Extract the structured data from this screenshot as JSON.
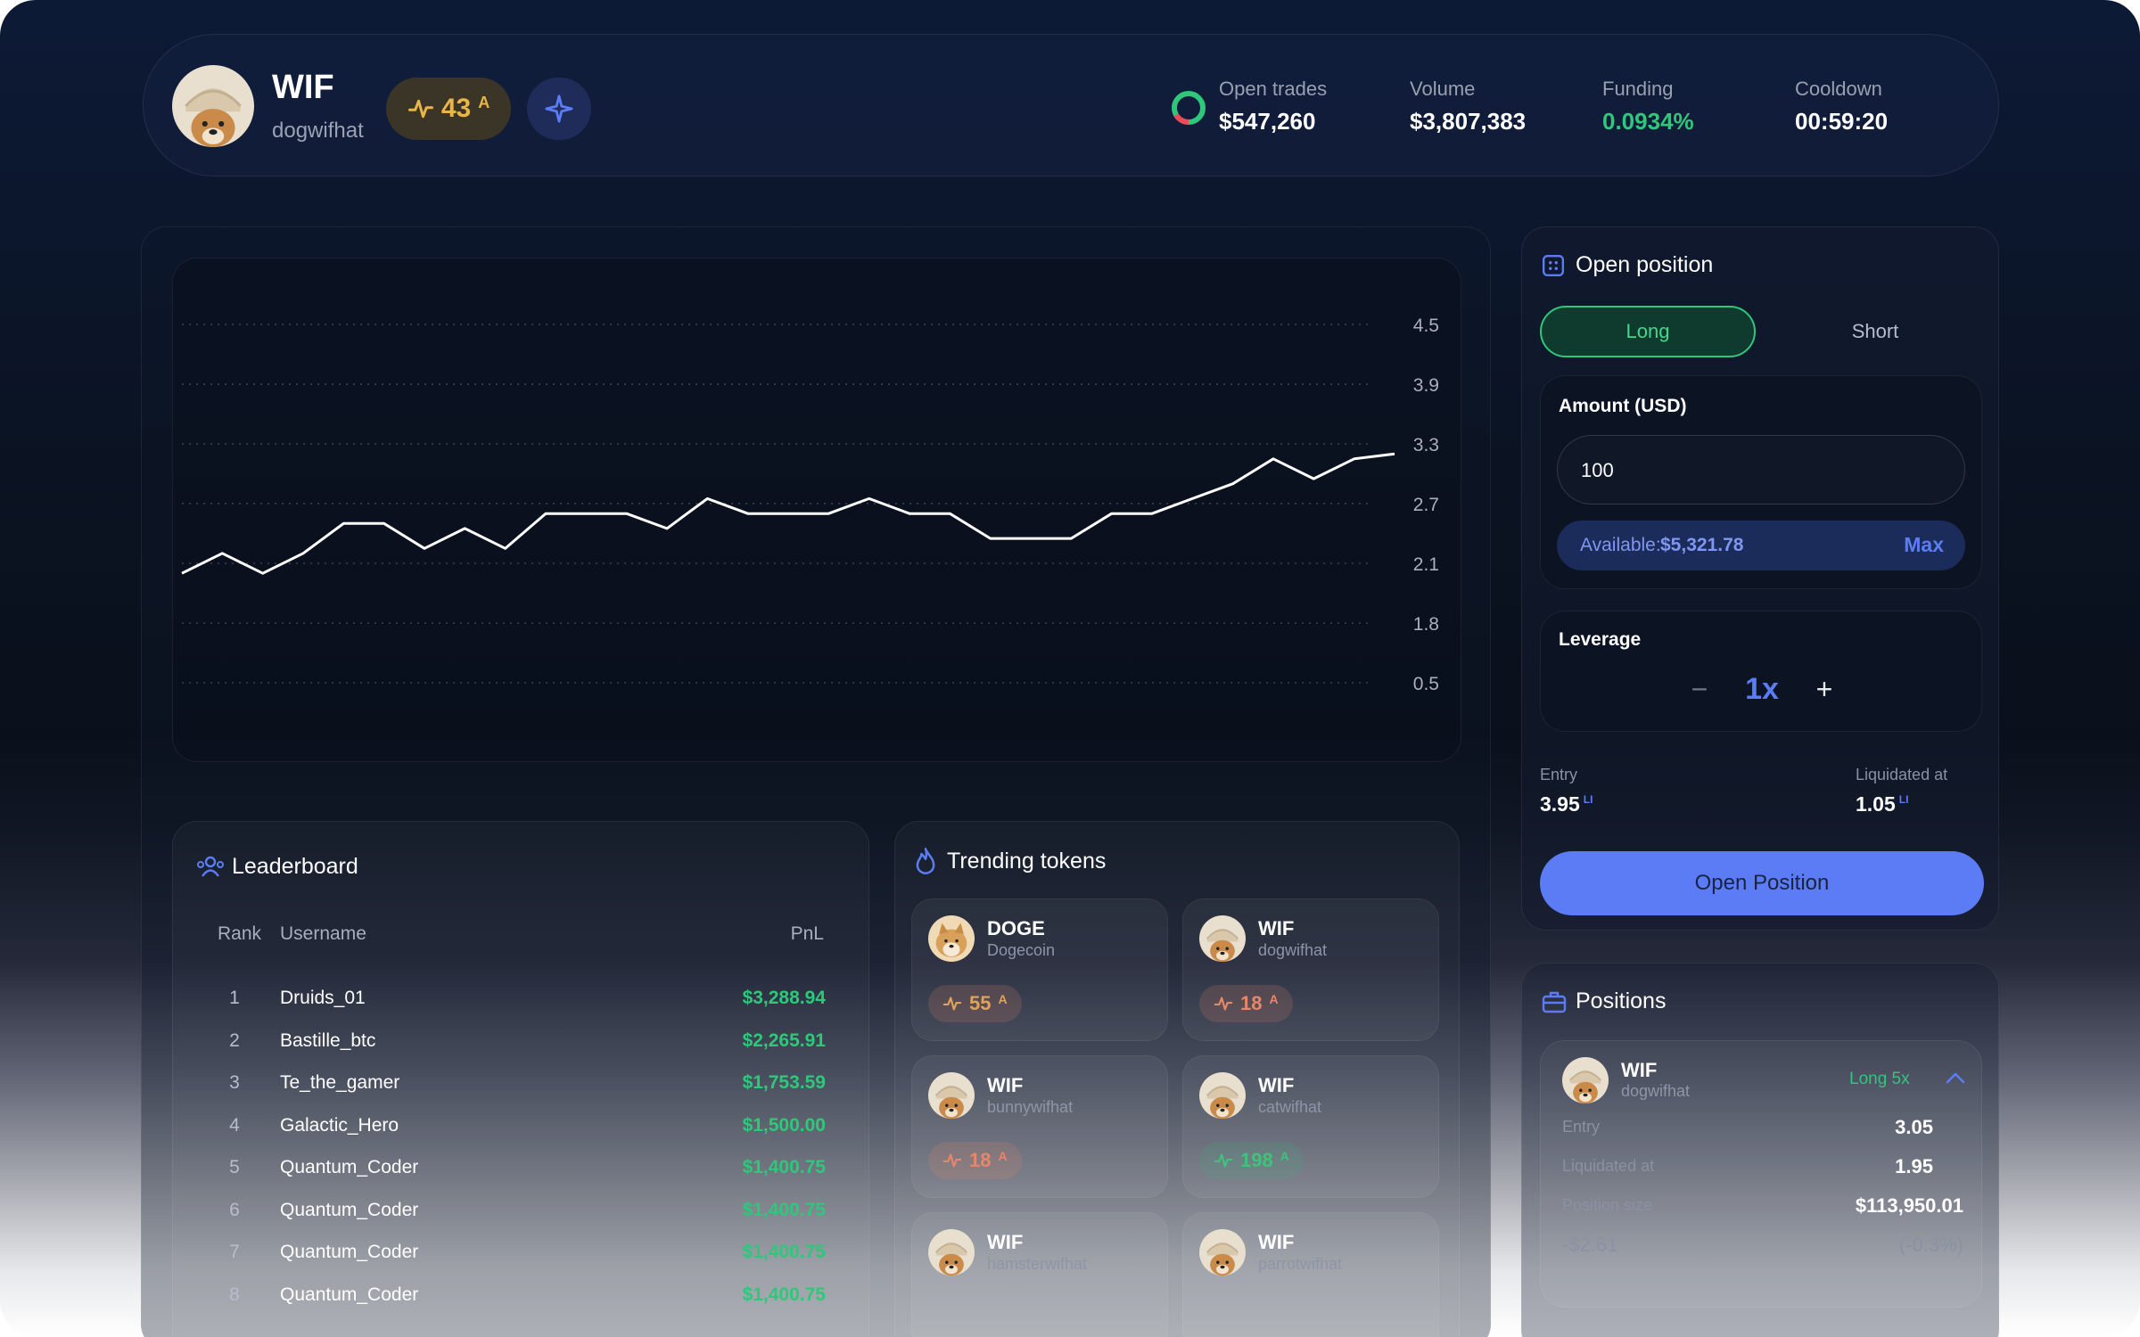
{
  "header": {
    "token_symbol": "WIF",
    "token_name": "dogwifhat",
    "score": "43",
    "score_grade": "A",
    "stats": [
      {
        "label": "Open trades",
        "value": "$547,260"
      },
      {
        "label": "Volume",
        "value": "$3,807,383"
      },
      {
        "label": "Funding",
        "value": "0.0934%"
      },
      {
        "label": "Cooldown",
        "value": "00:59:20"
      }
    ]
  },
  "chart_data": {
    "type": "line",
    "title": "",
    "xlabel": "",
    "ylabel": "",
    "y_tick_labels": [
      "4.5",
      "3.9",
      "3.3",
      "2.7",
      "2.1",
      "1.8",
      "0.5"
    ],
    "ylim": [
      1.5,
      4.5
    ],
    "values": [
      2.0,
      2.2,
      2.0,
      2.2,
      2.5,
      2.5,
      2.25,
      2.45,
      2.25,
      2.6,
      2.6,
      2.6,
      2.45,
      2.75,
      2.6,
      2.6,
      2.6,
      2.75,
      2.6,
      2.6,
      2.35,
      2.35,
      2.35,
      2.6,
      2.6,
      2.75,
      2.9,
      3.15,
      2.95,
      3.15,
      3.2
    ],
    "grid": true
  },
  "leaderboard": {
    "title": "Leaderboard",
    "columns": {
      "rank": "Rank",
      "username": "Username",
      "pnl": "PnL"
    },
    "rows": [
      {
        "rank": "1",
        "username": "Druids_01",
        "pnl": "$3,288.94"
      },
      {
        "rank": "2",
        "username": "Bastille_btc",
        "pnl": "$2,265.91"
      },
      {
        "rank": "3",
        "username": "Te_the_gamer",
        "pnl": "$1,753.59"
      },
      {
        "rank": "4",
        "username": "Galactic_Hero",
        "pnl": "$1,500.00"
      },
      {
        "rank": "5",
        "username": "Quantum_Coder",
        "pnl": "$1,400.75"
      },
      {
        "rank": "6",
        "username": "Quantum_Coder",
        "pnl": "$1,400.75"
      },
      {
        "rank": "7",
        "username": "Quantum_Coder",
        "pnl": "$1,400.75"
      },
      {
        "rank": "8",
        "username": "Quantum_Coder",
        "pnl": "$1,400.75"
      }
    ]
  },
  "trending": {
    "title": "Trending tokens",
    "tokens": [
      {
        "symbol": "DOGE",
        "name": "Dogecoin",
        "score": "55",
        "grade": "A",
        "color": "#e0a25a"
      },
      {
        "symbol": "WIF",
        "name": "dogwifhat",
        "score": "18",
        "grade": "A",
        "color": "#e6866a"
      },
      {
        "symbol": "WIF",
        "name": "bunnywifhat",
        "score": "18",
        "grade": "A",
        "color": "#e6866a"
      },
      {
        "symbol": "WIF",
        "name": "catwifhat",
        "score": "198",
        "grade": "A",
        "color": "#3fc27a"
      },
      {
        "symbol": "WIF",
        "name": "hamsterwifhat",
        "score": "",
        "grade": "",
        "color": "#e6866a"
      },
      {
        "symbol": "WIF",
        "name": "parrotwifhat",
        "score": "",
        "grade": "",
        "color": "#3fc27a"
      }
    ]
  },
  "open_position": {
    "title": "Open position",
    "long_label": "Long",
    "short_label": "Short",
    "amount_label": "Amount (USD)",
    "amount_value": "100",
    "available_label": "Available:",
    "available_value": "$5,321.78",
    "max_label": "Max",
    "leverage_label": "Leverage",
    "leverage_value": "1x",
    "entry_label": "Entry",
    "entry_value": "3.95",
    "entry_unit": "LI",
    "liq_label": "Liquidated at",
    "liq_value": "1.05",
    "liq_unit": "LI",
    "submit_label": "Open Position"
  },
  "positions": {
    "title": "Positions",
    "item": {
      "symbol": "WIF",
      "name": "dogwifhat",
      "side": "Long 5x",
      "entry_label": "Entry",
      "entry_value": "3.05",
      "liq_label": "Liquidated at",
      "liq_value": "1.95",
      "size_label": "Position size",
      "size_value": "$113,950.01",
      "pnl_value": "-$2.61",
      "pnl_pct": "(-0.3%)"
    }
  },
  "colors": {
    "accent": "#5b7cf5",
    "green": "#2fc77a",
    "gold": "#e8b547",
    "score_bg": "#3a3526"
  }
}
